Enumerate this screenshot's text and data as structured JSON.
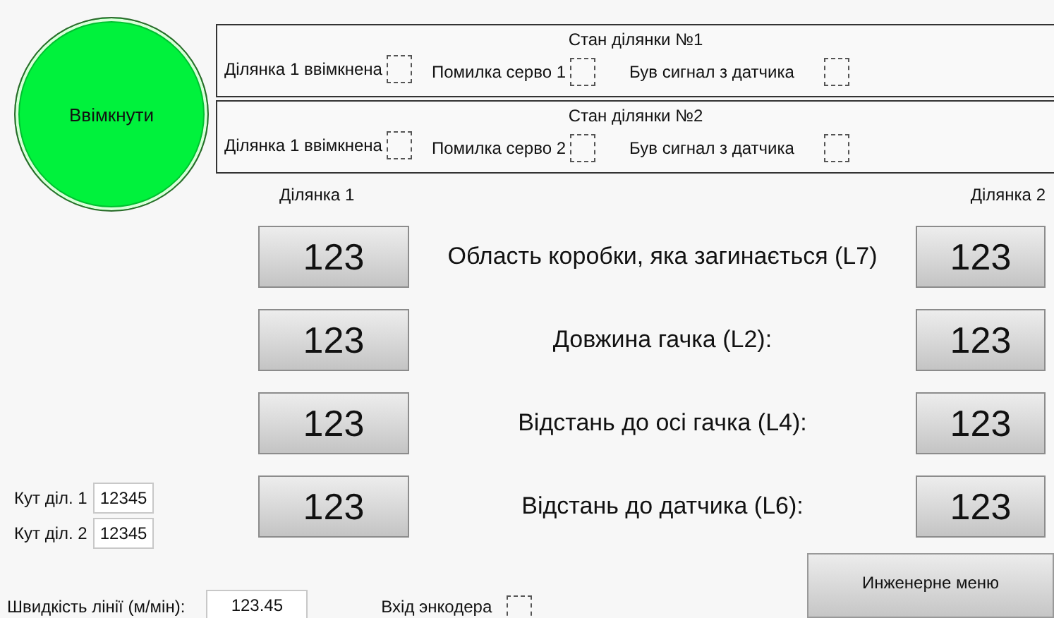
{
  "power_button": {
    "label": "Ввімкнути"
  },
  "sections": [
    {
      "title": "Стан ділянки №1",
      "indicators": [
        {
          "label": "Ділянка 1 ввімкнена",
          "checked": false
        },
        {
          "label": "Помилка серво 1",
          "checked": false
        },
        {
          "label": "Був сигнал з датчика",
          "checked": false
        }
      ]
    },
    {
      "title": "Стан ділянки №2",
      "indicators": [
        {
          "label": "Ділянка 1 ввімкнена",
          "checked": false
        },
        {
          "label": "Помилка серво 2",
          "checked": false
        },
        {
          "label": "Був сигнал з датчика",
          "checked": false
        }
      ]
    }
  ],
  "column_headers": [
    "Ділянка 1",
    "Ділянка 2"
  ],
  "parameters": [
    {
      "label": "Область коробки, яка загинається (L7)",
      "section_1": "123",
      "section_2": "123"
    },
    {
      "label": "Довжина гачка (L2):",
      "section_1": "123",
      "section_2": "123"
    },
    {
      "label": "Відстань до осі гачка (L4):",
      "section_1": "123",
      "section_2": "123"
    },
    {
      "label": "Відстань до датчика (L6):",
      "section_1": "123",
      "section_2": "123"
    }
  ],
  "angles": [
    {
      "label": "Кут діл. 1",
      "value": "12345"
    },
    {
      "label": "Кут діл. 2",
      "value": "12345"
    }
  ],
  "line_speed": {
    "label": "Швидкість лінії (м/мін):",
    "value": "123.45"
  },
  "encoder": {
    "label": "Вхід энкодера",
    "checked": false
  },
  "engineering_button": {
    "label": "Инженерне меню"
  }
}
